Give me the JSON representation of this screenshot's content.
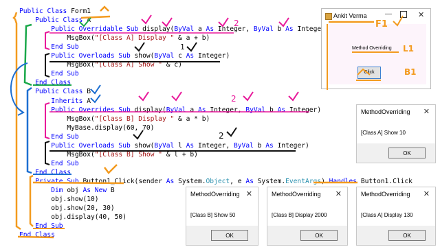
{
  "code_lines": [
    "Public Class Form1",
    "    Public Class A",
    "        Public Overridable Sub display(ByVal a As Integer, ByVal b As Integer)",
    "            MsgBox(\"[Class A] Display \" & a + b)",
    "        End Sub",
    "        Public Overloads Sub show(ByVal c As Integer)",
    "            MsgBox(\"[Class A] Show \" & c)",
    "        End Sub",
    "    End Class",
    "    Public Class B",
    "        Inherits A",
    "        Public Overrides Sub display(ByVal a As Integer, ByVal b As Integer)",
    "            MsgBox(\"[Class B] Display \" & a * b)",
    "            MyBase.display(60, 70)",
    "        End Sub",
    "        Public Overloads Sub show(ByVal l As Integer, ByVal b As Integer)",
    "            MsgBox(\"[Class B] Show \" & l + b)",
    "        End Sub",
    "    End Class",
    "    Private Sub Button1_Click(sender As System.Object, e As System.EventArgs) Handles Button1.Click",
    "        Dim obj As New B",
    "        obj.show(10)",
    "        obj.show(20, 30)",
    "        obj.display(40, 50)",
    "    End Sub",
    "End Class"
  ],
  "form_window": {
    "title": "Ankit Verma",
    "label": "Method Overriding",
    "button": "Click"
  },
  "message_boxes": [
    {
      "title": "MethodOverriding",
      "message": "[Class A] Show 10",
      "ok": "OK"
    },
    {
      "title": "MethodOverriding",
      "message": "[Class B] Show 50",
      "ok": "OK"
    },
    {
      "title": "MethodOverriding",
      "message": "[Class B] Display 2000",
      "ok": "OK"
    },
    {
      "title": "MethodOverriding",
      "message": "[Class A] Display 130",
      "ok": "OK"
    }
  ],
  "annotations": {
    "f1": "F1",
    "l1": "L1",
    "b1": "B1",
    "num1": "1",
    "num2": "2"
  },
  "colors": {
    "keyword": "#0000ff",
    "string": "#a31515",
    "type": "#2b91af",
    "ink_magenta": "#e8189a",
    "ink_green": "#1aa84a",
    "ink_blue": "#1d6fd1",
    "ink_orange": "#f39a1e",
    "ink_black": "#111111"
  }
}
